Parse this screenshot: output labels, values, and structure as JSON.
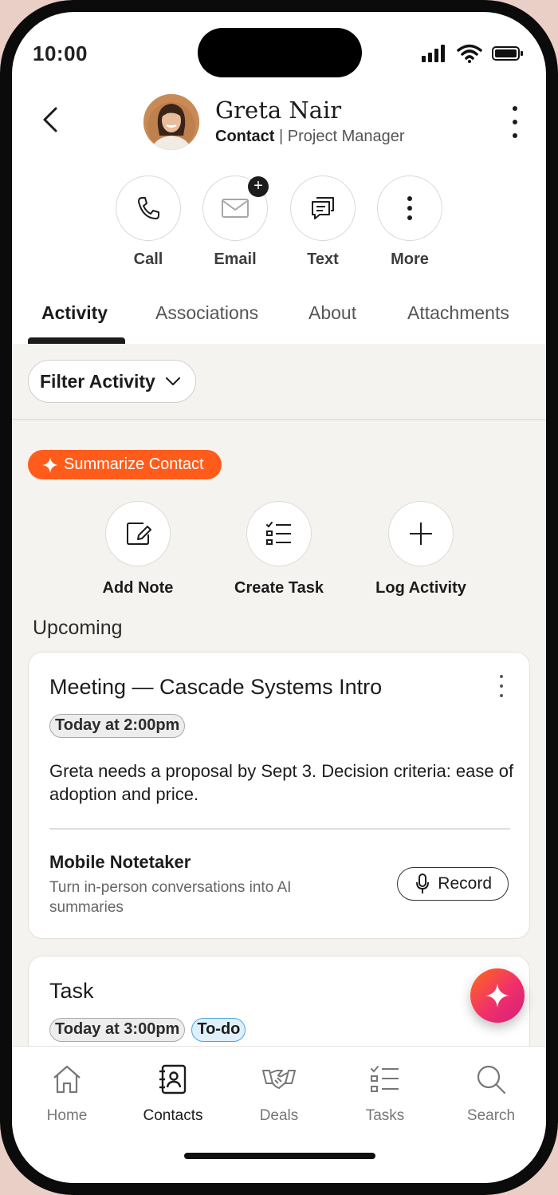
{
  "status_bar": {
    "time": "10:00"
  },
  "contact": {
    "name": "Greta Nair",
    "type": "Contact",
    "separator": "|",
    "title": "Project Manager"
  },
  "quick_actions": [
    {
      "label": "Call",
      "icon": "phone-icon"
    },
    {
      "label": "Email",
      "icon": "mail-icon"
    },
    {
      "label": "Text",
      "icon": "chat-icon"
    },
    {
      "label": "More",
      "icon": "more-vertical-icon"
    }
  ],
  "tabs": [
    {
      "label": "Activity",
      "active": true
    },
    {
      "label": "Associations",
      "active": false
    },
    {
      "label": "About",
      "active": false
    },
    {
      "label": "Attachments",
      "active": false
    }
  ],
  "filter": {
    "label": "Filter Activity"
  },
  "summarize": {
    "label": "Summarize Contact"
  },
  "activity_actions": [
    {
      "label": "Add Note",
      "icon": "note-edit-icon"
    },
    {
      "label": "Create Task",
      "icon": "checklist-icon"
    },
    {
      "label": "Log Activity",
      "icon": "plus-icon"
    }
  ],
  "section": {
    "upcoming": "Upcoming"
  },
  "meeting_card": {
    "title": "Meeting — Cascade Systems Intro",
    "time_chip": "Today at 2:00pm",
    "description": "Greta needs a proposal by Sept 3. Decision criteria: ease of adoption and price.",
    "notetaker_title": "Mobile Notetaker",
    "notetaker_desc": "Turn in-person conversations into AI summaries",
    "record_label": "Record"
  },
  "task_card": {
    "title": "Task",
    "time_chip": "Today at 3:00pm",
    "status_chip": "To-do"
  },
  "bottom_nav": [
    {
      "label": "Home",
      "icon": "home-icon",
      "active": false
    },
    {
      "label": "Contacts",
      "icon": "contacts-icon",
      "active": true
    },
    {
      "label": "Deals",
      "icon": "handshake-icon",
      "active": false
    },
    {
      "label": "Tasks",
      "icon": "tasks-icon",
      "active": false
    },
    {
      "label": "Search",
      "icon": "search-icon",
      "active": false
    }
  ],
  "colors": {
    "accent_orange": "#ff5c1b",
    "fab_gradient_start": "#ff6a1a",
    "fab_gradient_end": "#d31f7d",
    "chip_blue": "#4aa6de"
  }
}
